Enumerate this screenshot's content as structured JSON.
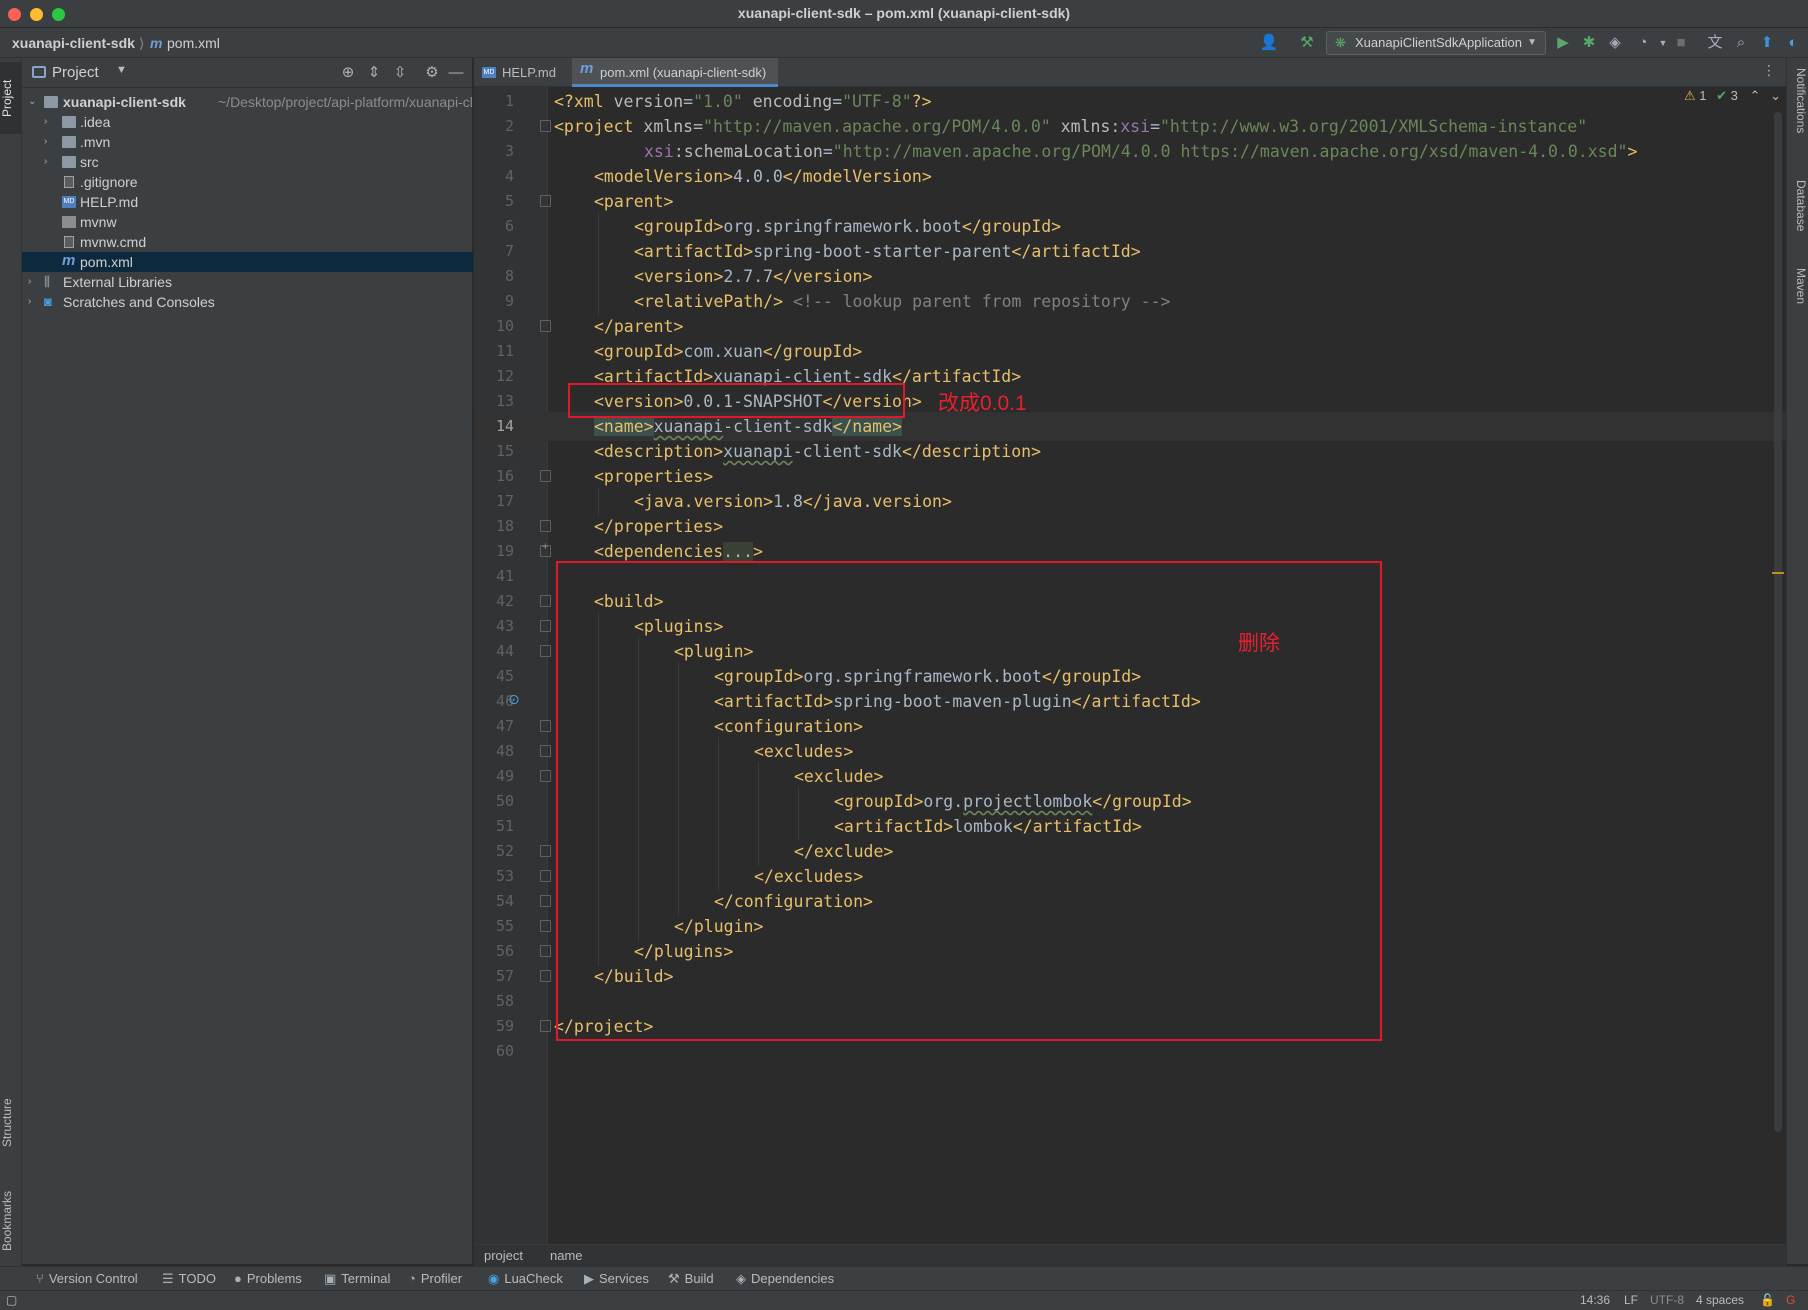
{
  "window": {
    "title": "xuanapi-client-sdk – pom.xml (xuanapi-client-sdk)"
  },
  "navbar": {
    "project": "xuanapi-client-sdk",
    "file_prefix": "m",
    "file": "pom.xml",
    "run_config": "XuanapiClientSdkApplication"
  },
  "left_strip": {
    "project": "Project",
    "structure": "Structure",
    "bookmarks": "Bookmarks"
  },
  "right_strip": {
    "notifications": "Notifications",
    "database": "Database",
    "maven": "Maven"
  },
  "project_panel": {
    "title": "Project",
    "root": {
      "name": "xuanapi-client-sdk",
      "path": "~/Desktop/project/api-platform/xuanapi-cl"
    },
    "items": [
      {
        "label": ".idea",
        "icon": "folder-icon"
      },
      {
        "label": ".mvn",
        "icon": "folder-icon"
      },
      {
        "label": "src",
        "icon": "folder-icon"
      },
      {
        "label": ".gitignore",
        "icon": "file-icon"
      },
      {
        "label": "HELP.md",
        "icon": "markdown-icon"
      },
      {
        "label": "mvnw",
        "icon": "terminal-file-icon"
      },
      {
        "label": "mvnw.cmd",
        "icon": "file-icon"
      },
      {
        "label": "pom.xml",
        "icon": "maven-icon"
      },
      {
        "label": "External Libraries",
        "icon": "library-icon"
      },
      {
        "label": "Scratches and Consoles",
        "icon": "scratch-icon"
      }
    ]
  },
  "tabs": [
    {
      "label": "HELP.md",
      "active": false
    },
    {
      "label": "pom.xml (xuanapi-client-sdk)",
      "active": true
    }
  ],
  "editor": {
    "inspections": {
      "warnings": "1",
      "ok": "3"
    },
    "caret_line": "14",
    "lines": [
      {
        "n": "1",
        "text": "<?xml version=\"1.0\" encoding=\"UTF-8\"?>"
      },
      {
        "n": "2",
        "text": "<project xmlns=\"http://maven.apache.org/POM/4.0.0\" xmlns:xsi=\"http://www.w3.org/2001/XMLSchema-instance\""
      },
      {
        "n": "3",
        "text": "xsi:schemaLocation=\"http://maven.apache.org/POM/4.0.0 https://maven.apache.org/xsd/maven-4.0.0.xsd\">"
      },
      {
        "n": "4",
        "text": "<modelVersion>4.0.0</modelVersion>"
      },
      {
        "n": "5",
        "text": "<parent>"
      },
      {
        "n": "6",
        "text": "<groupId>org.springframework.boot</groupId>"
      },
      {
        "n": "7",
        "text": "<artifactId>spring-boot-starter-parent</artifactId>"
      },
      {
        "n": "8",
        "text": "<version>2.7.7</version>"
      },
      {
        "n": "9",
        "text": "<relativePath/> <!-- lookup parent from repository -->"
      },
      {
        "n": "10",
        "text": "</parent>"
      },
      {
        "n": "11",
        "text": "<groupId>com.xuan</groupId>"
      },
      {
        "n": "12",
        "text": "<artifactId>xuanapi-client-sdk</artifactId>"
      },
      {
        "n": "13",
        "text": "<version>0.0.1-SNAPSHOT</version>"
      },
      {
        "n": "14",
        "text": "<name>xuanapi-client-sdk</name>"
      },
      {
        "n": "15",
        "text": "<description>xuanapi-client-sdk</description>"
      },
      {
        "n": "16",
        "text": "<properties>"
      },
      {
        "n": "17",
        "text": "<java.version>1.8</java.version>"
      },
      {
        "n": "18",
        "text": "</properties>"
      },
      {
        "n": "19",
        "text": "<dependencies...>"
      },
      {
        "n": "41",
        "text": ""
      },
      {
        "n": "42",
        "text": "<build>"
      },
      {
        "n": "43",
        "text": "<plugins>"
      },
      {
        "n": "44",
        "text": "<plugin>"
      },
      {
        "n": "45",
        "text": "<groupId>org.springframework.boot</groupId>"
      },
      {
        "n": "46",
        "text": "<artifactId>spring-boot-maven-plugin</artifactId>"
      },
      {
        "n": "47",
        "text": "<configuration>"
      },
      {
        "n": "48",
        "text": "<excludes>"
      },
      {
        "n": "49",
        "text": "<exclude>"
      },
      {
        "n": "50",
        "text": "<groupId>org.projectlombok</groupId>"
      },
      {
        "n": "51",
        "text": "<artifactId>lombok</artifactId>"
      },
      {
        "n": "52",
        "text": "</exclude>"
      },
      {
        "n": "53",
        "text": "</excludes>"
      },
      {
        "n": "54",
        "text": "</configuration>"
      },
      {
        "n": "55",
        "text": "</plugin>"
      },
      {
        "n": "56",
        "text": "</plugins>"
      },
      {
        "n": "57",
        "text": "</build>"
      },
      {
        "n": "58",
        "text": ""
      },
      {
        "n": "59",
        "text": "</project>"
      },
      {
        "n": "60",
        "text": ""
      }
    ]
  },
  "annotations": {
    "version_note": "改成0.0.1",
    "build_note": "删除",
    "color": "#e0192a"
  },
  "breadcrumb": [
    "project",
    "name"
  ],
  "tool_windows": [
    "Version Control",
    "TODO",
    "Problems",
    "Terminal",
    "Profiler",
    "LuaCheck",
    "Services",
    "Build",
    "Dependencies"
  ],
  "status": {
    "position": "14:36",
    "line_sep": "LF",
    "encoding": "UTF-8",
    "indent": "4 spaces"
  }
}
